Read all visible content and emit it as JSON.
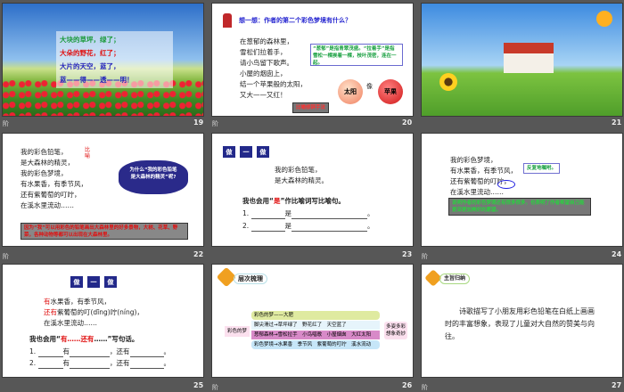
{
  "slides": [
    {
      "number": "19",
      "anim_icon": "阶",
      "lines": [
        "大块的草坪，绿了；",
        "大朵的野花，红了；",
        "大片的天空，蓝了，",
        "蓝——得——透——明！"
      ]
    },
    {
      "number": "20",
      "anim_icon": "阶",
      "title": "想一想：作者的第二个彩色梦境有什么？",
      "lines": [
        "在葱郁的森林里，",
        "雪松们拉着手，",
        "请小鸟留下歌声。",
        "小屋的烟囱上，",
        "结一个苹果般的太阳，",
        "又大——又红！"
      ],
      "note": "“葱郁”是指青翠茂盛。“拉着手”是指 雪松一棵挨着一棵，枝叶茂密，连在一起。",
      "sun": "太阳",
      "like": "像",
      "apple": "苹果",
      "technique": "比喻修辞手法"
    },
    {
      "number": "21"
    },
    {
      "number": "22",
      "anim_icon": "阶",
      "lines": [
        "我的彩色铅笔，",
        "是大森林的精灵，",
        "我的彩色梦境，",
        "有水果香，有季节风，",
        "还有紫葡萄的叮咛，",
        "在溪水里流动……"
      ],
      "tag": "比喻",
      "cloud": "为什么“我的彩色铅笔是大森林的精灵”呢?",
      "note": "因为“我”可以用彩色的铅笔画出大森林里的好多景物，大树、花草、野菜，各种动物等都可以出现在大森林里。"
    },
    {
      "number": "23",
      "zuo": [
        "做",
        "一",
        "做"
      ],
      "lines": [
        "我的彩色铅笔，",
        "是大森林的精灵。"
      ],
      "red_word": "是",
      "prompt_pre": "我也会用“",
      "prompt_red": "是",
      "prompt_post": "”作比喻词写比喻句。",
      "blanks": [
        "1.",
        "2."
      ],
      "blank_word": "是"
    },
    {
      "number": "24",
      "anim_icon": "阶",
      "lines": [
        "我的彩色梦境，",
        "有水果香，有季节风，",
        "还有紫葡萄的叮咛，",
        "在溪水里流动……"
      ],
      "callout": "反复地嘱咐。",
      "note": "说明作者的彩色梦境还有很多很多，也表明了作者希望自己能更深更加美好的愿望。"
    },
    {
      "number": "25",
      "zuo": [
        "做",
        "一",
        "做"
      ],
      "lines": [
        [
          "有",
          "水果香，有季节风，"
        ],
        [
          "还有",
          "紫葡萄的叮(dīng)咛(níng)，"
        ],
        [
          "",
          "在溪水里流动……"
        ]
      ],
      "prompt_pre": "我也会用“",
      "prompt_red1": "有……",
      "prompt_red2": "还有",
      "prompt_post": "……”写句话。",
      "blanks": [
        "1.",
        "2."
      ],
      "w1": "有",
      "w2": "，还有"
    },
    {
      "number": "26",
      "anim_icon": "阶",
      "heading": "层次梳理",
      "root": "彩色的梦",
      "rows": [
        "彩色的梦——大肥",
        "脚尖滑过→草坪绿了　野花红了　天空蓝了",
        "葱郁森林→雪松拉手　小鸟唱歌　小屋烟囱　大红太阳",
        "彩色梦境→水果香　季节风　紫葡萄的叮咛　溪水流动"
      ],
      "summary": [
        "多姿多彩",
        "想象奇妙"
      ]
    },
    {
      "number": "27",
      "anim_icon": "阶",
      "heading": "主旨归纳",
      "text": "诗歌描写了小朋友用彩色铅笔在白纸上画画时的丰富想象，表现了儿童对大自然的赞美与向往。"
    }
  ]
}
